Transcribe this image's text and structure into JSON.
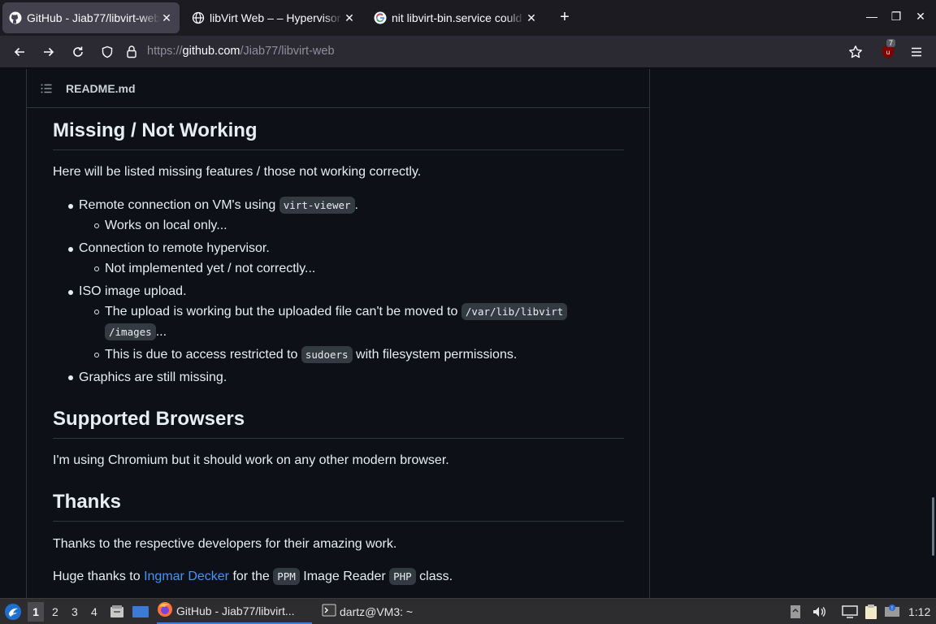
{
  "browser": {
    "tabs": [
      {
        "title": "GitHub - Jiab77/libvirt-web",
        "icon": "github-icon",
        "active": true
      },
      {
        "title": "libVirt Web – – Hypervisor",
        "icon": "globe-icon",
        "active": false
      },
      {
        "title": "nit libvirt-bin.service could",
        "icon": "google-icon",
        "active": false
      }
    ],
    "new_tab_label": "+",
    "url_prefix": "https://",
    "url_host": "github.com",
    "url_path": "/Jiab77/libvirt-web",
    "extension_badge": "7"
  },
  "readme": {
    "filename": "README.md",
    "section_missing": {
      "heading": "Missing / Not Working",
      "intro": "Here will be listed missing features / those not working correctly.",
      "item1": "Remote connection on VM's using ",
      "item1_code": "virt-viewer",
      "item1_end": ".",
      "item1_sub": "Works on local only...",
      "item2": "Connection to remote hypervisor.",
      "item2_sub": "Not implemented yet / not correctly...",
      "item3": "ISO image upload.",
      "item3_sub1": "The upload is working but the uploaded file can't be moved to ",
      "item3_sub1_code_a": "/var/lib/libvirt",
      "item3_sub1_code_b": "/images",
      "item3_sub1_end": "...",
      "item3_sub2": "This is due to access restricted to ",
      "item3_sub2_code": "sudoers",
      "item3_sub2_end": " with filesystem permissions.",
      "item4": "Graphics are still missing."
    },
    "section_browsers": {
      "heading": "Supported Browsers",
      "text": "I'm using Chromium but it should work on any other modern browser."
    },
    "section_thanks": {
      "heading": "Thanks",
      "text1": "Thanks to the respective developers for their amazing work.",
      "text2_a": "Huge thanks to ",
      "text2_link": "Ingmar Decker",
      "text2_b": " for the ",
      "text2_code1": "PPM",
      "text2_c": " Image Reader ",
      "text2_code2": "PHP",
      "text2_d": " class."
    }
  },
  "taskbar": {
    "workspaces": [
      "1",
      "2",
      "3",
      "4"
    ],
    "active_workspace": "1",
    "tasks": [
      {
        "title": "GitHub - Jiab77/libvirt...",
        "icon": "firefox-icon"
      },
      {
        "title": "dartz@VM3: ~",
        "icon": "terminal-icon"
      }
    ],
    "clock": "1:12"
  },
  "colors": {
    "accent_link": "#4493f8",
    "page_bg": "#0d1117"
  }
}
